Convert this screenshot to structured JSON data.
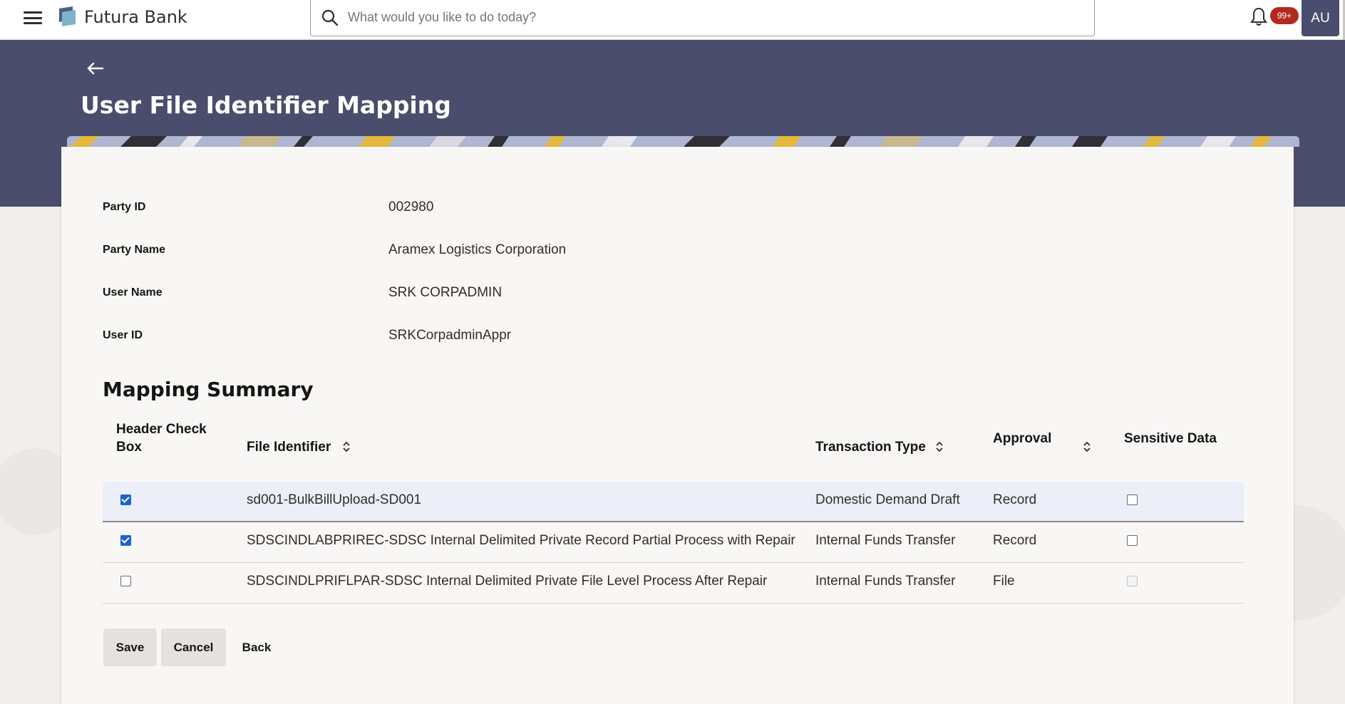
{
  "app": {
    "brand": "Futura Bank",
    "notifications_count": "99+",
    "user_initials": "AU",
    "colors": {
      "header": "#4a4d6b",
      "badge": "#b2291e",
      "checkbox_checked": "#1d63d1"
    }
  },
  "search": {
    "placeholder": "What would you like to do today?"
  },
  "page": {
    "title": "User File Identifier Mapping"
  },
  "details": {
    "party_id_label": "Party ID",
    "party_id_value": "002980",
    "party_name_label": "Party Name",
    "party_name_value": "Aramex Logistics Corporation",
    "user_name_label": "User Name",
    "user_name_value": "SRK CORPADMIN",
    "user_id_label": "User ID",
    "user_id_value": "SRKCorpadminAppr"
  },
  "mapping": {
    "title": "Mapping Summary",
    "columns": {
      "header_check_line1": "Header Check",
      "header_check_line2": "Box",
      "file_identifier": "File Identifier",
      "transaction_type": "Transaction Type",
      "approval": "Approval",
      "sensitive": "Sensitive Data"
    },
    "rows": [
      {
        "checked": true,
        "file_identifier": "sd001-BulkBillUpload-SD001",
        "transaction_type": "Domestic Demand Draft",
        "approval": "Record",
        "sensitive_checked": false,
        "sensitive_disabled": false
      },
      {
        "checked": true,
        "file_identifier": "SDSCINDLABPRIREC-SDSC Internal Delimited Private Record Partial Process with Repair",
        "transaction_type": "Internal Funds Transfer",
        "approval": "Record",
        "sensitive_checked": false,
        "sensitive_disabled": false
      },
      {
        "checked": false,
        "file_identifier": "SDSCINDLPRIFLPAR-SDSC Internal Delimited Private File Level Process After Repair",
        "transaction_type": "Internal Funds Transfer",
        "approval": "File",
        "sensitive_checked": false,
        "sensitive_disabled": true
      }
    ]
  },
  "actions": {
    "save": "Save",
    "cancel": "Cancel",
    "back": "Back"
  }
}
